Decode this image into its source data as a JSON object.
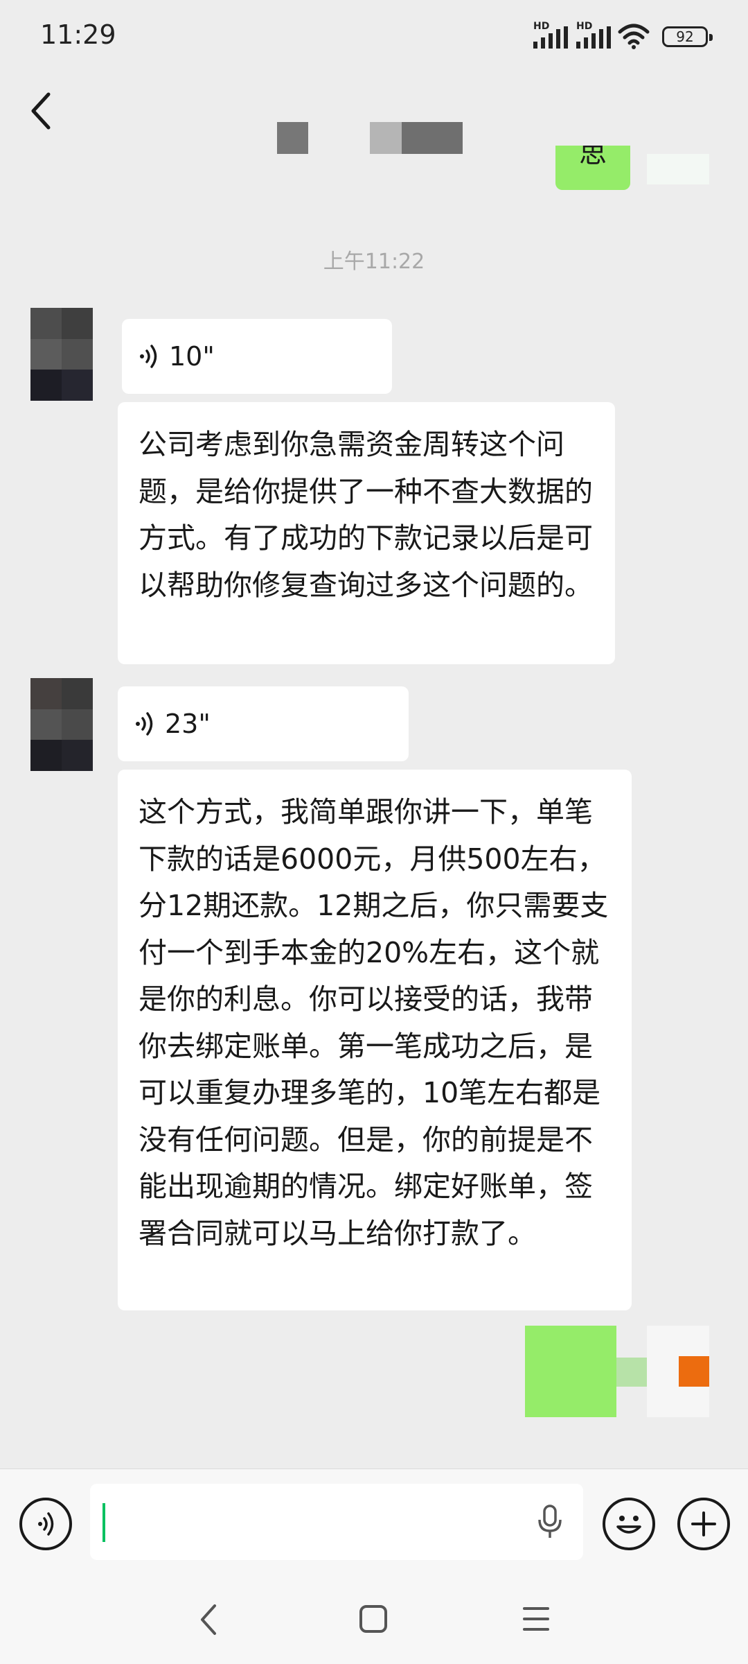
{
  "status": {
    "time": "11:29",
    "hd1": "HD",
    "hd2": "HD",
    "battery": "92"
  },
  "chat": {
    "timestamp": "上午11:22",
    "messages": [
      {
        "type": "voice",
        "duration": "10\""
      },
      {
        "type": "text",
        "text": "公司考虑到你急需资金周转这个问题，是给你提供了一种不查大数据的方式。有了成功的下款记录以后是可以帮助你修复查询过多这个问题的。"
      },
      {
        "type": "voice",
        "duration": "23\""
      },
      {
        "type": "text",
        "text": "这个方式，我简单跟你讲一下，单笔下款的话是6000元，月供500左右，分12期还款。12期之后，你只需要支付一个到手本金的20%左右，这个就是你的利息。你可以接受的话，我带你去绑定账单。第一笔成功之后，是可以重复办理多笔的，10笔左右都是没有任何问题。但是，你的前提是不能出现逾期的情况。绑定好账单，签署合同就可以马上给你打款了。"
      }
    ]
  },
  "partial_outgoing_text": "思",
  "colors": {
    "background": "#ededed",
    "bubble_in": "#ffffff",
    "bubble_out": "#95ec69",
    "cursor": "#07c160",
    "timestamp": "#a8a8a8"
  },
  "icons": {
    "back": "back-chevron-icon",
    "voice": "voice-wave-icon",
    "mic": "microphone-icon",
    "emoji": "emoji-icon",
    "plus": "plus-icon",
    "nav_back": "nav-back-icon",
    "nav_home": "nav-home-icon",
    "nav_menu": "nav-menu-icon"
  }
}
